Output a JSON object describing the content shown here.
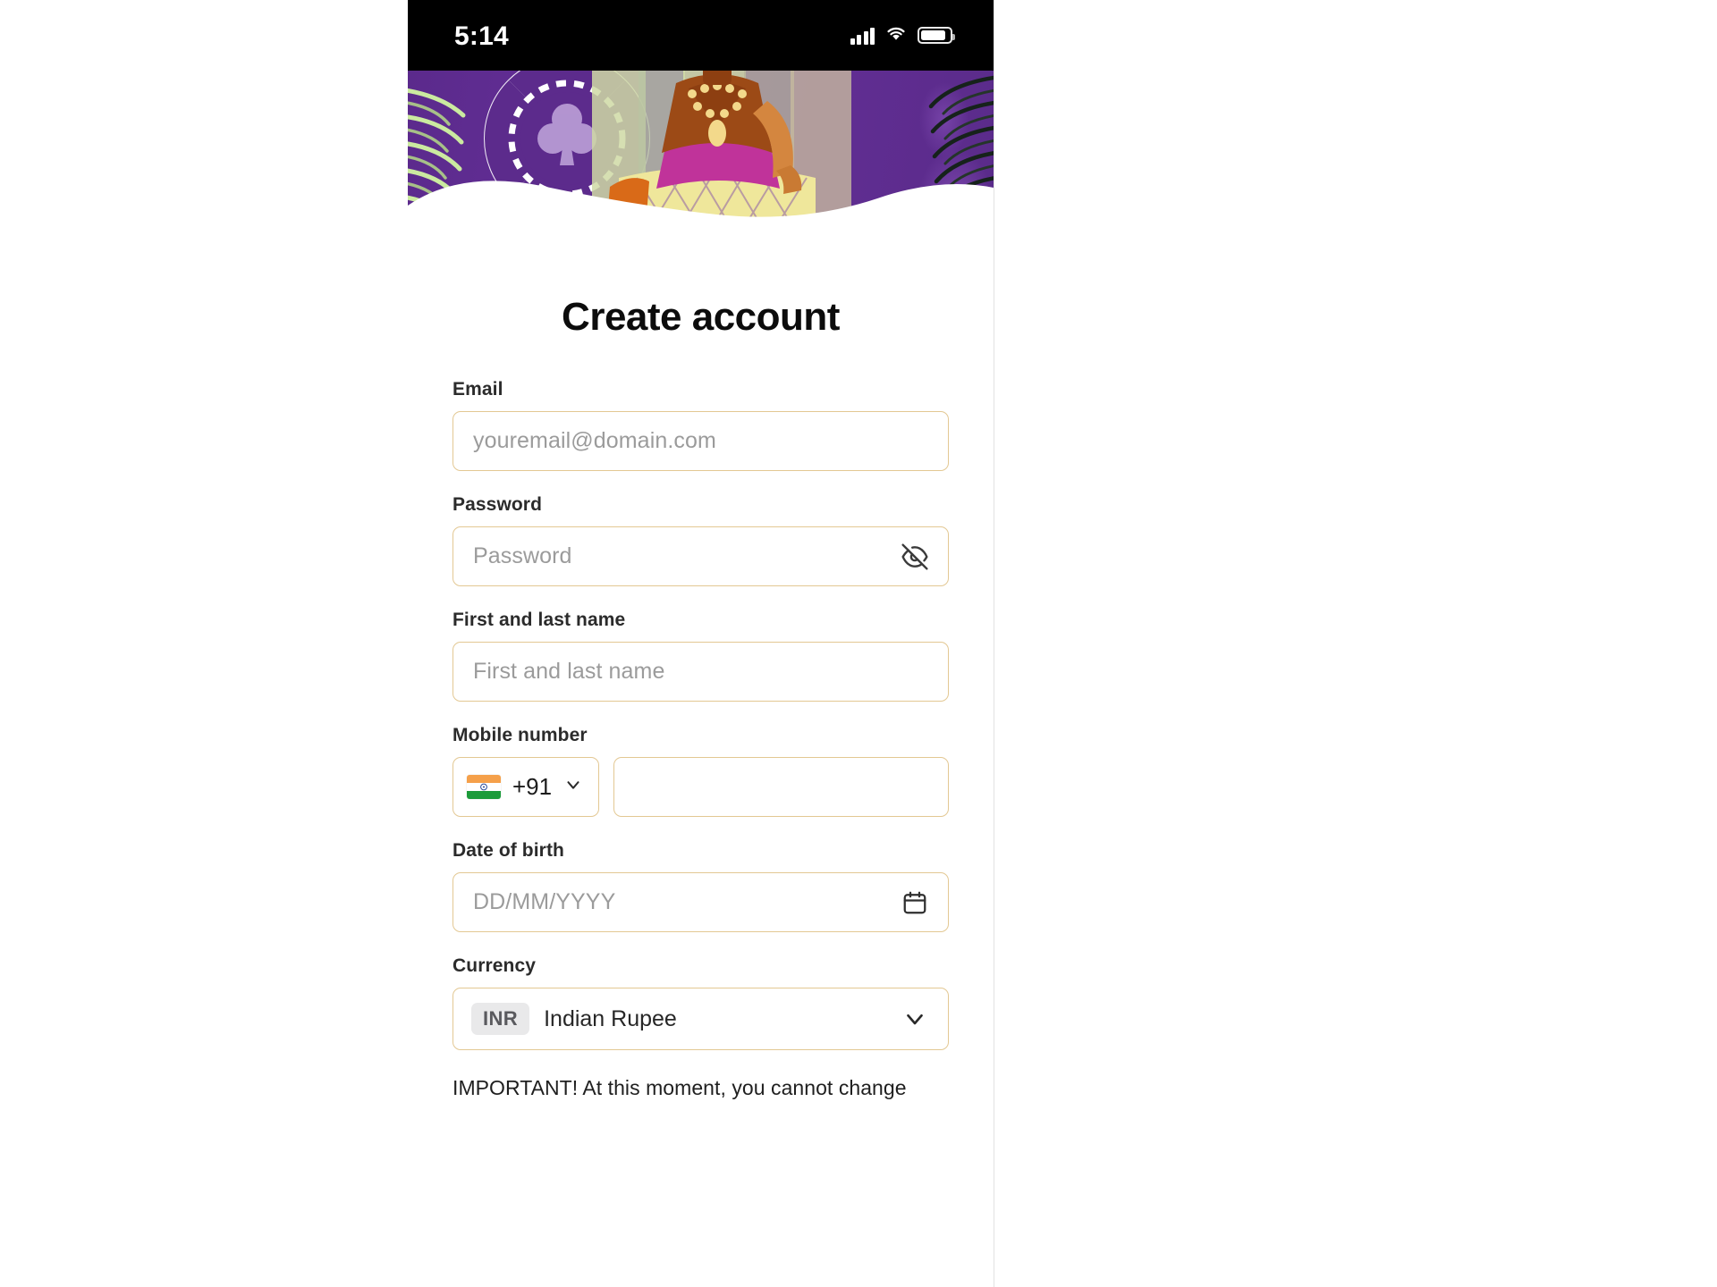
{
  "status_bar": {
    "time": "5:14",
    "icons": [
      "cellular-signal-icon",
      "wifi-icon",
      "battery-icon"
    ]
  },
  "hero": {
    "alt": "casino-chip-and-dancer-illustration",
    "colors": {
      "purple": "#5f2d8f",
      "purple_dark": "#4a2173",
      "chip_white": "#ffffff",
      "frond_green": "#c6e59a",
      "fern_dark": "#1e2b22",
      "skin": "#d4863f",
      "dress_brown": "#9c4a16",
      "dress_magenta": "#c0339a",
      "dress_yellow": "#efe08a",
      "gold": "#f3d98b"
    }
  },
  "page": {
    "title": "Create account"
  },
  "fields": {
    "email": {
      "label": "Email",
      "placeholder": "youremail@domain.com",
      "value": ""
    },
    "password": {
      "label": "Password",
      "placeholder": "Password",
      "value": "",
      "toggle_icon": "eye-off-icon"
    },
    "full_name": {
      "label": "First and last name",
      "placeholder": "First and last name",
      "value": ""
    },
    "mobile": {
      "label": "Mobile number",
      "country_flag": "india-flag-icon",
      "dial_code": "+91",
      "dropdown_icon": "chevron-down-icon",
      "value": "",
      "placeholder": ""
    },
    "date_of_birth": {
      "label": "Date of birth",
      "placeholder": "DD/MM/YYYY",
      "value": "",
      "trailing_icon": "calendar-icon"
    },
    "currency": {
      "label": "Currency",
      "code": "INR",
      "name": "Indian Rupee",
      "dropdown_icon": "chevron-down-icon"
    }
  },
  "notice": {
    "text": "IMPORTANT! At this moment, you cannot change"
  },
  "theme": {
    "border": "#e3c893",
    "placeholder": "#9b9b9b",
    "label": "#2b2b2b",
    "title": "#0c0c0c",
    "badge_bg": "#e9e9ea"
  }
}
